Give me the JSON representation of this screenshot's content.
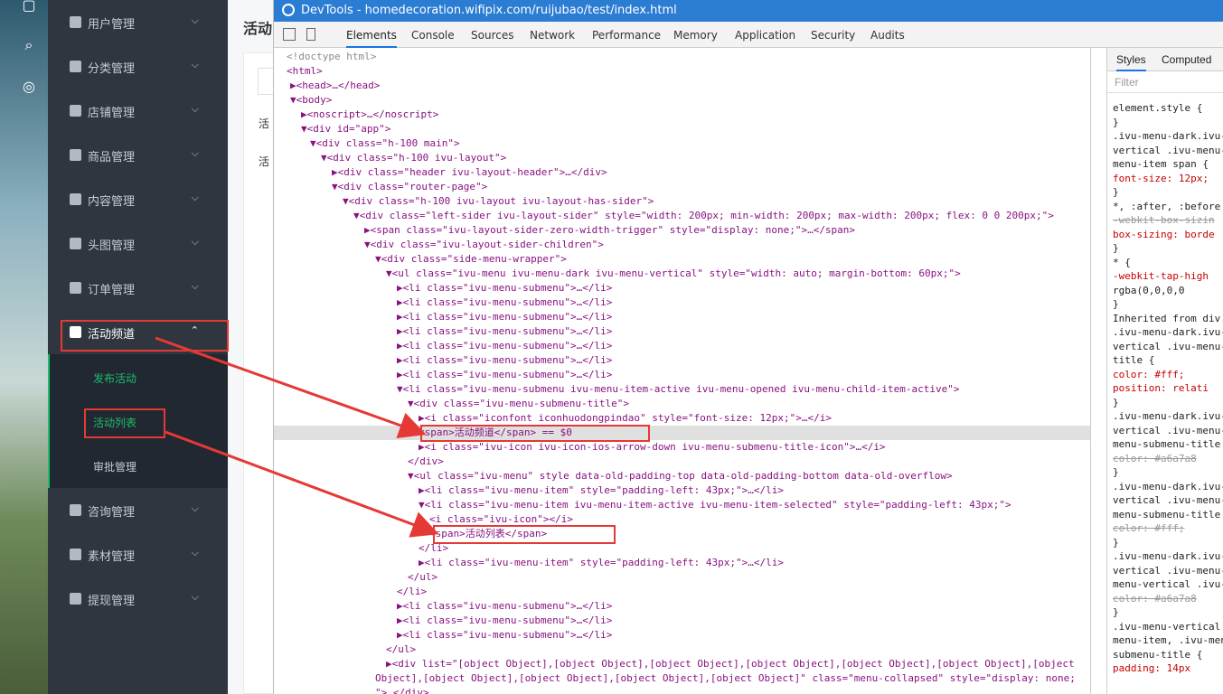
{
  "devtools": {
    "title": "DevTools - homedecoration.wifipix.com/ruijubao/test/index.html",
    "tabs": [
      "Elements",
      "Console",
      "Sources",
      "Network",
      "Performance",
      "Memory",
      "Application",
      "Security",
      "Audits"
    ],
    "active_tab": "Elements"
  },
  "sidebar": {
    "items": [
      {
        "label": "用户管理",
        "icon": "user-icon"
      },
      {
        "label": "分类管理",
        "icon": "grid-icon"
      },
      {
        "label": "店铺管理",
        "icon": "shop-icon"
      },
      {
        "label": "商品管理",
        "icon": "goods-icon"
      },
      {
        "label": "内容管理",
        "icon": "content-icon"
      },
      {
        "label": "头图管理",
        "icon": "image-icon"
      },
      {
        "label": "订单管理",
        "icon": "order-icon"
      },
      {
        "label": "活动频道",
        "icon": "gift-icon"
      },
      {
        "label": "咨询管理",
        "icon": "consult-icon"
      },
      {
        "label": "素材管理",
        "icon": "folder-icon"
      },
      {
        "label": "提现管理",
        "icon": "withdraw-icon"
      }
    ],
    "submenu": [
      "发布活动",
      "活动列表",
      "审批管理"
    ]
  },
  "page": {
    "title": "活动",
    "labels": [
      "活",
      "活"
    ]
  },
  "dom_lines": [
    {
      "t": "<!doctype html>",
      "cls": "cm"
    },
    {
      "t": "<html>"
    },
    {
      "t": "▶<head>…</head>"
    },
    {
      "t": "▼<body>"
    },
    {
      "t": "▶<noscript>…</noscript>"
    },
    {
      "t": "▼<div id=\"app\">"
    },
    {
      "t": "▼<div class=\"h-100 main\">"
    },
    {
      "t": "▼<div class=\"h-100 ivu-layout\">"
    },
    {
      "t": "▶<div class=\"header ivu-layout-header\">…</div>"
    },
    {
      "t": "▼<div class=\"router-page\">"
    },
    {
      "t": "▼<div class=\"h-100 ivu-layout ivu-layout-has-sider\">"
    },
    {
      "t": "▼<div class=\"left-sider ivu-layout-sider\" style=\"width: 200px; min-width: 200px; max-width: 200px; flex: 0 0 200px;\">"
    },
    {
      "t": "▶<span class=\"ivu-layout-sider-zero-width-trigger\" style=\"display: none;\">…</span>"
    },
    {
      "t": "▼<div class=\"ivu-layout-sider-children\">"
    },
    {
      "t": "▼<div class=\"side-menu-wrapper\">"
    },
    {
      "t": "▼<ul class=\"ivu-menu ivu-menu-dark ivu-menu-vertical\" style=\"width: auto; margin-bottom: 60px;\">"
    },
    {
      "t": "▶<li class=\"ivu-menu-submenu\">…</li>"
    },
    {
      "t": "▶<li class=\"ivu-menu-submenu\">…</li>"
    },
    {
      "t": "▶<li class=\"ivu-menu-submenu\">…</li>"
    },
    {
      "t": "▶<li class=\"ivu-menu-submenu\">…</li>"
    },
    {
      "t": "▶<li class=\"ivu-menu-submenu\">…</li>"
    },
    {
      "t": "▶<li class=\"ivu-menu-submenu\">…</li>"
    },
    {
      "t": "▶<li class=\"ivu-menu-submenu\">…</li>"
    },
    {
      "t": "▼<li class=\"ivu-menu-submenu ivu-menu-item-active ivu-menu-opened ivu-menu-child-item-active\">"
    },
    {
      "t": "▼<div class=\"ivu-menu-submenu-title\">"
    },
    {
      "t": "▶<i class=\"iconfont iconhuodongpindao\" style=\"font-size: 12px;\">…</i>"
    },
    {
      "t": "<span>活动频道</span> == $0",
      "sel": true
    },
    {
      "t": "▶<i class=\"ivu-icon ivu-icon-ios-arrow-down ivu-menu-submenu-title-icon\">…</i>"
    },
    {
      "t": "</div>"
    },
    {
      "t": "▼<ul class=\"ivu-menu\" style data-old-padding-top data-old-padding-bottom data-old-overflow>"
    },
    {
      "t": "▶<li class=\"ivu-menu-item\" style=\"padding-left: 43px;\">…</li>"
    },
    {
      "t": "▼<li class=\"ivu-menu-item ivu-menu-item-active ivu-menu-item-selected\" style=\"padding-left: 43px;\">"
    },
    {
      "t": "<i class=\"ivu-icon\"></i>"
    },
    {
      "t": "<span>活动列表</span>"
    },
    {
      "t": "</li>"
    },
    {
      "t": "▶<li class=\"ivu-menu-item\" style=\"padding-left: 43px;\">…</li>"
    },
    {
      "t": "</ul>"
    },
    {
      "t": "</li>"
    },
    {
      "t": "▶<li class=\"ivu-menu-submenu\">…</li>"
    },
    {
      "t": "▶<li class=\"ivu-menu-submenu\">…</li>"
    },
    {
      "t": "▶<li class=\"ivu-menu-submenu\">…</li>"
    },
    {
      "t": "</ul>"
    },
    {
      "t": "▶<div list=\"[object Object],[object Object],[object Object],[object Object],[object Object],[object Object],[object"
    },
    {
      "t": "Object],[object Object],[object Object],[object Object],[object Object]\" class=\"menu-collapsed\" style=\"display: none;"
    },
    {
      "t": "\">…</div>"
    }
  ],
  "styles_panel": {
    "tabs": [
      "Styles",
      "Computed"
    ],
    "filter_placeholder": "Filter",
    "lines": [
      "element.style {",
      "}",
      ".ivu-menu-dark.ivu-",
      "vertical .ivu-menu-",
      "menu-item span {",
      "  font-size: 12px;",
      "}",
      "*, :after, :before",
      "  -webkit-box-sizin",
      "  box-sizing: borde",
      "}",
      "* {",
      "  -webkit-tap-high",
      "    rgba(0,0,0,0",
      "}",
      "Inherited from div.iv",
      ".ivu-menu-dark.ivu-",
      "vertical .ivu-menu-",
      "title {",
      "  color: #fff;",
      "  position: relati",
      "}",
      ".ivu-menu-dark.ivu-",
      "vertical .ivu-menu-",
      "menu-submenu-title",
      "  color: #a6a7a8",
      "}",
      ".ivu-menu-dark.ivu-",
      "vertical .ivu-menu-",
      "menu-submenu-title",
      "  color: #fff;",
      "}",
      ".ivu-menu-dark.ivu-",
      "vertical .ivu-menu-",
      "menu-vertical .ivu-",
      "  color: #a6a7a8",
      "}",
      ".ivu-menu-vertical",
      "menu-item, .ivu-men",
      "submenu-title {",
      "  padding: 14px"
    ]
  }
}
